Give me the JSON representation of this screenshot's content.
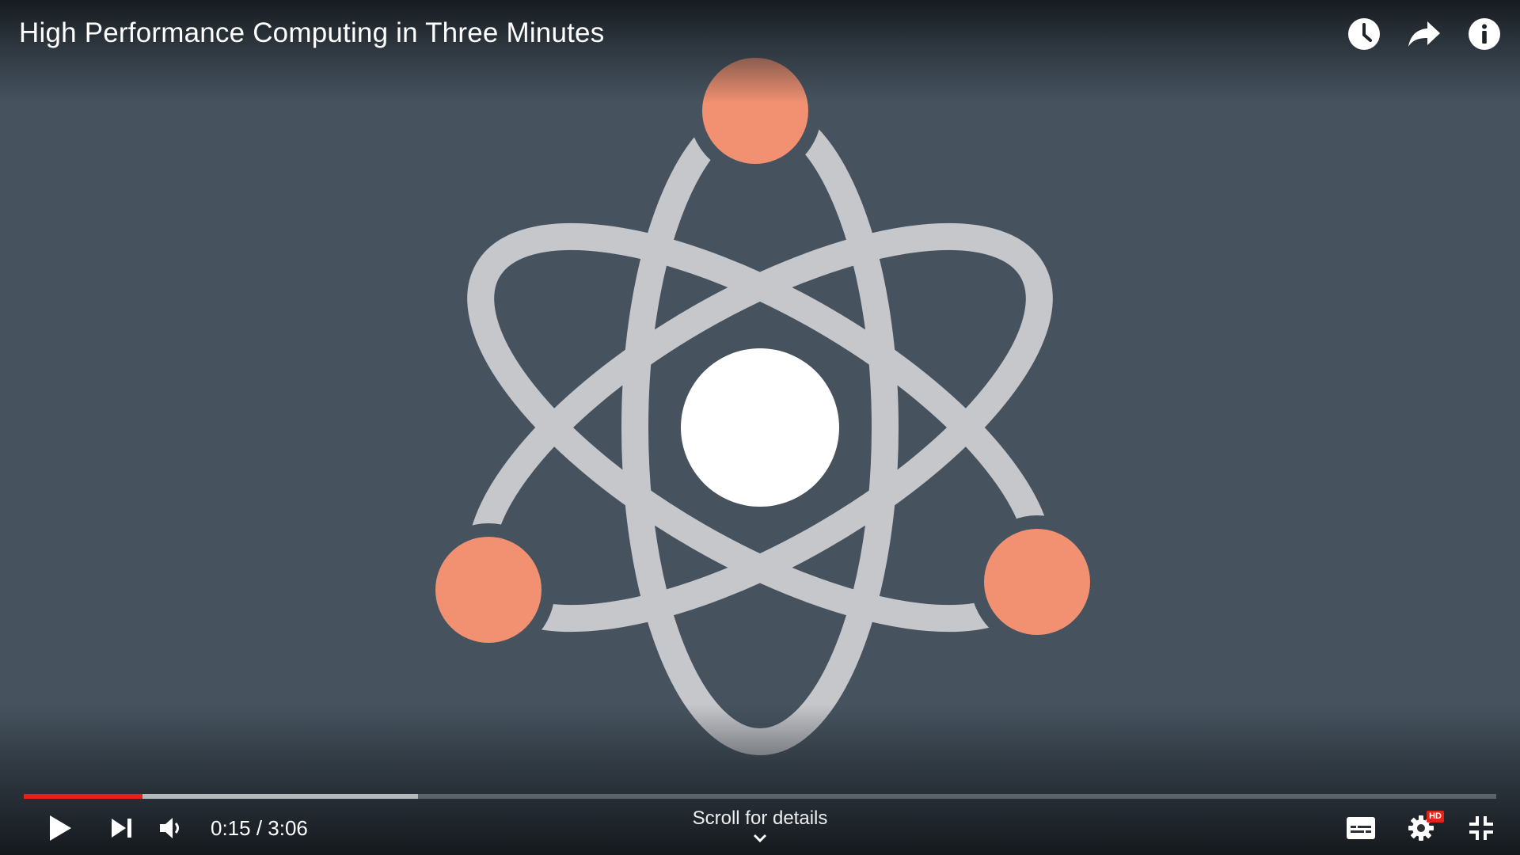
{
  "video": {
    "title": "High Performance Computing in Three Minutes"
  },
  "top_actions": [
    {
      "name": "watch-later",
      "icon": "clock-icon"
    },
    {
      "name": "share",
      "icon": "share-arrow-icon"
    },
    {
      "name": "info",
      "icon": "info-icon"
    }
  ],
  "progress": {
    "played_fraction": 0.0806,
    "buffered_fraction": 0.268,
    "played_color": "#e62117"
  },
  "controls": {
    "current_time": "0:15",
    "duration": "3:06",
    "time_display": "0:15 / 3:06",
    "scroll_hint": "Scroll for details",
    "settings_badge": "HD"
  },
  "colors": {
    "background": "#46535f",
    "orbit": "#c6c7cb",
    "electron": "#f19171",
    "nucleus": "#ffffff"
  }
}
